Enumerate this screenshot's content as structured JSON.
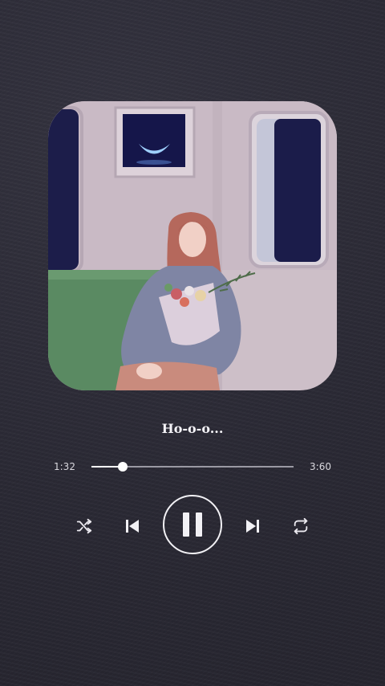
{
  "player": {
    "song_title": "Ho-o-o...",
    "current_time": "1:32",
    "total_time": "3:60",
    "progress": 0.155
  },
  "controls": {
    "shuffle_icon": "shuffle-icon",
    "previous_icon": "skip-previous-icon",
    "pause_icon": "pause-icon",
    "next_icon": "skip-next-icon",
    "repeat_icon": "repeat-icon"
  },
  "colors": {
    "background": "#2b2a36",
    "text": "#f1f0f4",
    "track": "#9a99a3"
  }
}
